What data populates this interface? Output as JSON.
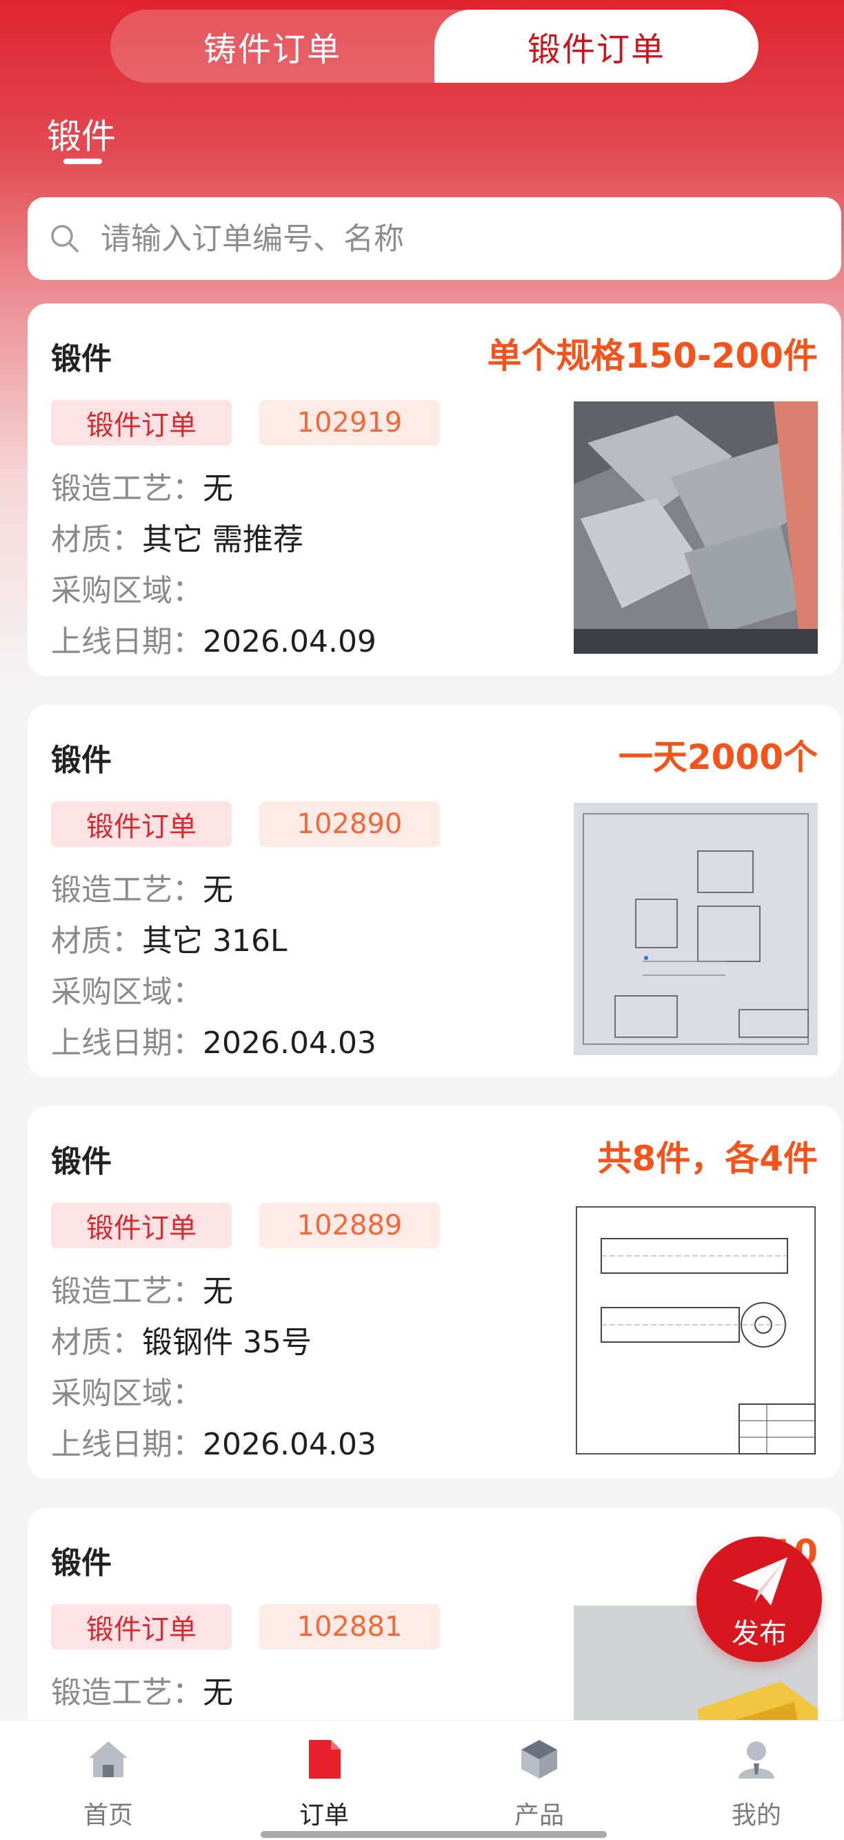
{
  "top_tabs": [
    {
      "label": "铸件订单",
      "active": false
    },
    {
      "label": "锻件订单",
      "active": true
    }
  ],
  "sub_tab": {
    "label": "锻件"
  },
  "search": {
    "placeholder": "请输入订单编号、名称"
  },
  "field_labels": {
    "process": "锻造工艺：",
    "material": "材质：",
    "region": "采购区域：",
    "date": "上线日期："
  },
  "orders": [
    {
      "title": "锻件",
      "quantity": "单个规格150-200件",
      "type_tag": "锻件订单",
      "number": "102919",
      "process": "无",
      "material": "其它  需推荐",
      "region": "",
      "date": "2026.04.09",
      "image": "cast-parts-photo"
    },
    {
      "title": "锻件",
      "quantity": "一天2000个",
      "type_tag": "锻件订单",
      "number": "102890",
      "process": "无",
      "material": "其它  316L",
      "region": "",
      "date": "2026.04.03",
      "image": "technical-drawing-photo"
    },
    {
      "title": "锻件",
      "quantity": "共8件，各4件",
      "type_tag": "锻件订单",
      "number": "102889",
      "process": "无",
      "material": "锻钢件  35号",
      "region": "",
      "date": "2026.04.03",
      "image": "shaft-drawing"
    },
    {
      "title": "锻件",
      "quantity": "10",
      "type_tag": "锻件订单",
      "number": "102881",
      "process": "无",
      "image": "yellow-part-photo"
    }
  ],
  "fab": {
    "label": "发布",
    "icon": "paper-plane-icon"
  },
  "bottom_nav": [
    {
      "label": "首页",
      "icon": "home-icon",
      "active": false
    },
    {
      "label": "订单",
      "icon": "order-doc-icon",
      "active": true
    },
    {
      "label": "产品",
      "icon": "product-box-icon",
      "active": false
    },
    {
      "label": "我的",
      "icon": "user-icon",
      "active": false
    }
  ],
  "colors": {
    "brand_red": "#d8161e",
    "quantity_orange": "#f2541b",
    "tag_red": "#d42a30"
  }
}
